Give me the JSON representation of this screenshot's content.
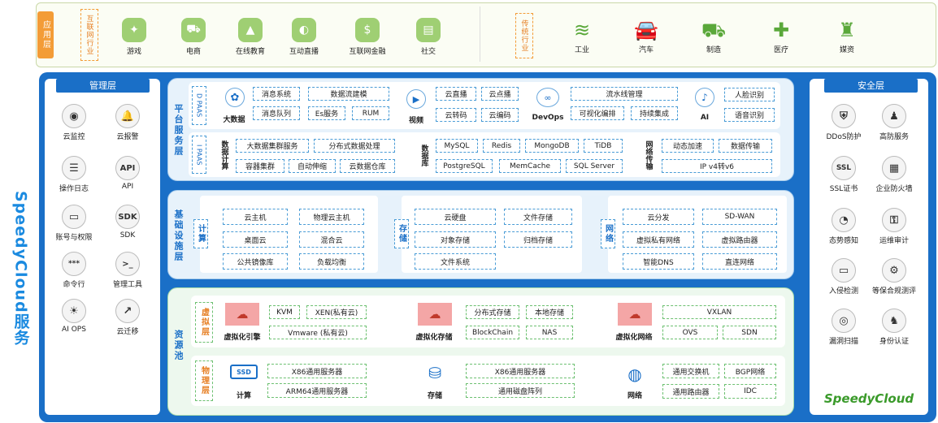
{
  "app_layer": {
    "title": "应用层",
    "internet_label": "互联网行业",
    "internet_items": [
      {
        "label": "游戏",
        "icon": "gamepad-icon"
      },
      {
        "label": "电商",
        "icon": "cart-icon"
      },
      {
        "label": "在线教育",
        "icon": "graduation-icon"
      },
      {
        "label": "互动直播",
        "icon": "live-icon"
      },
      {
        "label": "互联网金融",
        "icon": "dollar-icon"
      },
      {
        "label": "社交",
        "icon": "chat-icon"
      }
    ],
    "traditional_label": "传统行业",
    "traditional_items": [
      {
        "label": "工业",
        "icon": "factory-icon"
      },
      {
        "label": "汽车",
        "icon": "car-icon"
      },
      {
        "label": "制造",
        "icon": "manufacturing-icon"
      },
      {
        "label": "医疗",
        "icon": "medical-icon"
      },
      {
        "label": "媒资",
        "icon": "shirt-icon"
      }
    ]
  },
  "side_title": "SpeedyCloud服务",
  "management": {
    "title": "管理层",
    "items": [
      {
        "label": "云监控",
        "glyph": "◉"
      },
      {
        "label": "云报警",
        "glyph": "🔔"
      },
      {
        "label": "操作日志",
        "glyph": "☰"
      },
      {
        "label": "API",
        "glyph": "API"
      },
      {
        "label": "账号与权限",
        "glyph": "▭"
      },
      {
        "label": "SDK",
        "glyph": "SDK"
      },
      {
        "label": "命令行",
        "glyph": "***"
      },
      {
        "label": "管理工具",
        "glyph": ">_"
      },
      {
        "label": "AI OPS",
        "glyph": "☀"
      },
      {
        "label": "云迁移",
        "glyph": "↗"
      }
    ]
  },
  "security": {
    "title": "安全层",
    "items": [
      {
        "label": "DDoS防护",
        "glyph": "⛨"
      },
      {
        "label": "高防服务",
        "glyph": "♟"
      },
      {
        "label": "SSL证书",
        "glyph": "SSL"
      },
      {
        "label": "企业防火墙",
        "glyph": "▦"
      },
      {
        "label": "态势感知",
        "glyph": "◔"
      },
      {
        "label": "运维审计",
        "glyph": "⚿"
      },
      {
        "label": "入侵检测",
        "glyph": "▭"
      },
      {
        "label": "等保合规测评",
        "glyph": "⚙"
      },
      {
        "label": "漏洞扫描",
        "glyph": "◎"
      },
      {
        "label": "身份认证",
        "glyph": "♞"
      }
    ]
  },
  "platform": {
    "title": "平台服务层",
    "dpaas_label": "D PAAS",
    "ipaas_label": "I PAAS",
    "bigdata": {
      "label": "大数据",
      "items": [
        "消息系统",
        "数据流建模",
        "消息队列",
        "Es服务",
        "RUM"
      ]
    },
    "video": {
      "label": "视频",
      "items": [
        "云直播",
        "云点播",
        "云转码",
        "云编码"
      ]
    },
    "devops": {
      "label": "DevOps",
      "items": [
        "流水线管理",
        "可视化编排",
        "持续集成"
      ]
    },
    "ai": {
      "label": "AI",
      "items": [
        "人脸识别",
        "语音识别"
      ]
    },
    "datacompute": {
      "label": "数据计算",
      "items": [
        "大数据集群服务",
        "分布式数据处理",
        "容器集群",
        "自动伸缩",
        "云数据仓库"
      ]
    },
    "database": {
      "label": "数据库",
      "items": [
        "MySQL",
        "Redis",
        "MongoDB",
        "TiDB",
        "PostgreSQL",
        "MemCache",
        "SQL Server"
      ]
    },
    "network": {
      "label": "网络传输",
      "items": [
        "动态加速",
        "数据传输",
        "IP v4转v6"
      ]
    }
  },
  "infra": {
    "title": "基础设施层",
    "compute": {
      "label": "计算",
      "items": [
        "云主机",
        "物理云主机",
        "桌面云",
        "混合云",
        "公共镜像库",
        "负载均衡"
      ]
    },
    "storage": {
      "label": "存储",
      "items": [
        "云硬盘",
        "文件存储",
        "对象存储",
        "归档存储",
        "文件系统"
      ]
    },
    "network": {
      "label": "网络",
      "items": [
        "云分发",
        "SD-WAN",
        "虚拟私有网络",
        "虚拟路由器",
        "智能DNS",
        "直连网络"
      ]
    }
  },
  "resource": {
    "title": "资源池",
    "virtual": {
      "label": "虚拟层",
      "engine": {
        "label": "虚拟化引擎",
        "items": [
          "KVM",
          "XEN(私有云)",
          "Vmware (私有云)"
        ]
      },
      "storage": {
        "label": "虚拟化存储",
        "items": [
          "分布式存储",
          "本地存储",
          "BlockChain",
          "NAS"
        ]
      },
      "network": {
        "label": "虚拟化网络",
        "items": [
          "VXLAN",
          "OVS",
          "SDN"
        ]
      }
    },
    "physical": {
      "label": "物理层",
      "compute": {
        "label": "计算",
        "items": [
          "X86通用服务器",
          "ARM64通用服务器"
        ]
      },
      "storage": {
        "label": "存储",
        "items": [
          "X86通用服务器",
          "通用磁盘阵列"
        ]
      },
      "network": {
        "label": "网络",
        "items": [
          "通用交换机",
          "BGP网络",
          "通用路由器",
          "IDC"
        ]
      }
    }
  },
  "logo": "SpeedyCloud",
  "colors": {
    "blue": "#1a6fc7",
    "green": "#5aa83a",
    "orange": "#f39c37",
    "light_blue_bg": "#e7f2fb",
    "light_green_bg": "#edf8ee"
  }
}
